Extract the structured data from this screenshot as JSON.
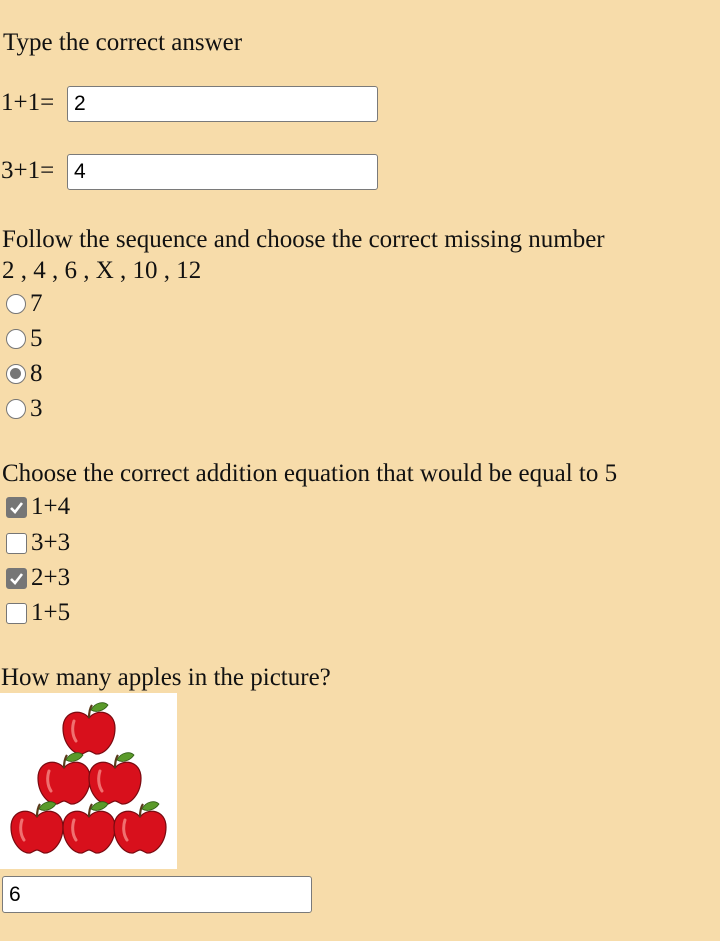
{
  "q1": {
    "title": "Type the correct answer",
    "items": [
      {
        "prompt": "1+1=",
        "value": "2"
      },
      {
        "prompt": "3+1=",
        "value": "4"
      }
    ]
  },
  "q2": {
    "title": "Follow the sequence and choose the correct missing number",
    "sequence": "2 , 4 , 6 , X , 10 , 12",
    "options": [
      {
        "label": "7",
        "selected": false
      },
      {
        "label": "5",
        "selected": false
      },
      {
        "label": "8",
        "selected": true
      },
      {
        "label": "3",
        "selected": false
      }
    ]
  },
  "q3": {
    "title": "Choose the correct addition equation that would be equal to 5",
    "options": [
      {
        "label": "1+4",
        "checked": true
      },
      {
        "label": "3+3",
        "checked": false
      },
      {
        "label": "2+3",
        "checked": true
      },
      {
        "label": "1+5",
        "checked": false
      }
    ]
  },
  "q4": {
    "title": "How many apples in the picture?",
    "image_icon": "apple-pyramid-image",
    "apple_count": 6,
    "answer": "6"
  },
  "colors": {
    "background": "#f7dcaa",
    "apple": "#d8101c",
    "leaf": "#5a9a2a",
    "control": "#767676"
  }
}
